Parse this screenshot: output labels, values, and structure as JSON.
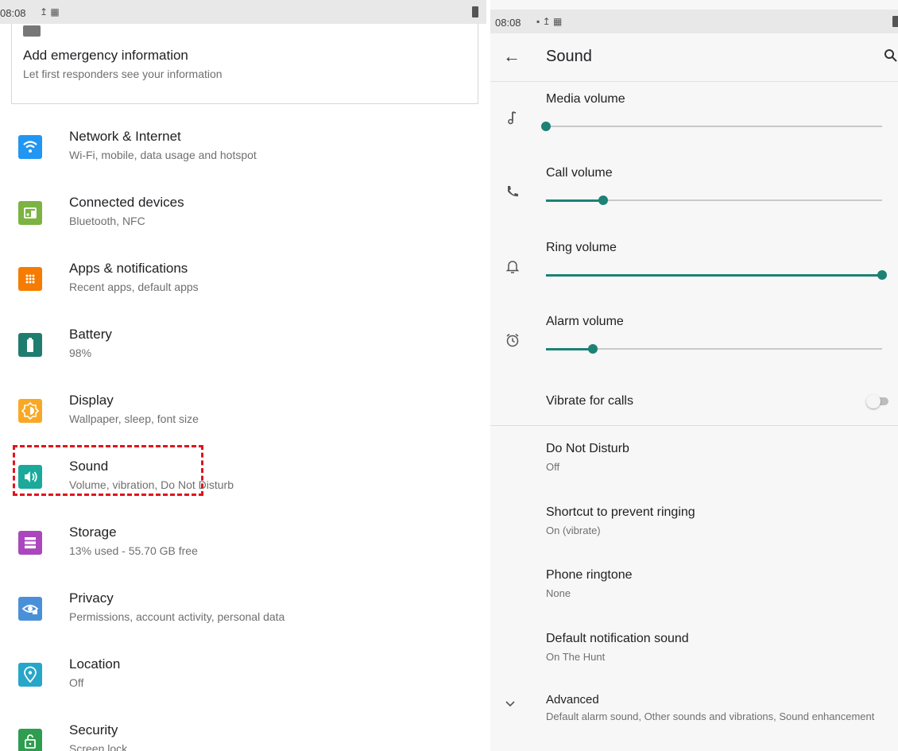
{
  "left": {
    "status_time": "08:08",
    "status_icons": "↥ ▦",
    "emergency": {
      "title": "Add emergency information",
      "subtitle": "Let first responders see your information"
    },
    "items": [
      {
        "title": "Network & Internet",
        "subtitle": "Wi-Fi, mobile, data usage and hotspot",
        "icon": "wifi-icon",
        "color": "#2196f3"
      },
      {
        "title": "Connected devices",
        "subtitle": "Bluetooth, NFC",
        "icon": "devices-icon",
        "color": "#7cb342"
      },
      {
        "title": "Apps & notifications",
        "subtitle": "Recent apps, default apps",
        "icon": "apps-icon",
        "color": "#f57c00"
      },
      {
        "title": "Battery",
        "subtitle": "98%",
        "icon": "battery-icon",
        "color": "#1e7d6e"
      },
      {
        "title": "Display",
        "subtitle": "Wallpaper, sleep, font size",
        "icon": "brightness-icon",
        "color": "#f9a825"
      },
      {
        "title": "Sound",
        "subtitle": "Volume, vibration, Do Not Disturb",
        "icon": "volume-icon",
        "color": "#1aa99a"
      },
      {
        "title": "Storage",
        "subtitle": "13% used - 55.70 GB free",
        "icon": "storage-icon",
        "color": "#ab47bc"
      },
      {
        "title": "Privacy",
        "subtitle": "Permissions, account activity, personal data",
        "icon": "privacy-icon",
        "color": "#4a90d9"
      },
      {
        "title": "Location",
        "subtitle": "Off",
        "icon": "location-icon",
        "color": "#26a6c9"
      },
      {
        "title": "Security",
        "subtitle": "Screen lock",
        "icon": "lock-icon",
        "color": "#2e9d4f"
      }
    ]
  },
  "right": {
    "status_time": "08:08",
    "status_icons": "▪ ↥ ▦",
    "title": "Sound",
    "volumes": [
      {
        "label": "Media volume",
        "icon": "music-note-icon",
        "level": 0.0
      },
      {
        "label": "Call volume",
        "icon": "phone-icon",
        "level": 0.17
      },
      {
        "label": "Ring volume",
        "icon": "bell-icon",
        "level": 1.0
      },
      {
        "label": "Alarm volume",
        "icon": "alarm-icon",
        "level": 0.14
      }
    ],
    "vibrate_label": "Vibrate for calls",
    "vibrate_on": false,
    "prefs": [
      {
        "title": "Do Not Disturb",
        "subtitle": "Off"
      },
      {
        "title": "Shortcut to prevent ringing",
        "subtitle": "On (vibrate)"
      },
      {
        "title": "Phone ringtone",
        "subtitle": "None"
      },
      {
        "title": "Default notification sound",
        "subtitle": "On The Hunt"
      }
    ],
    "advanced": {
      "title": "Advanced",
      "subtitle": "Default alarm sound, Other sounds and vibrations, Sound enhancement"
    }
  }
}
